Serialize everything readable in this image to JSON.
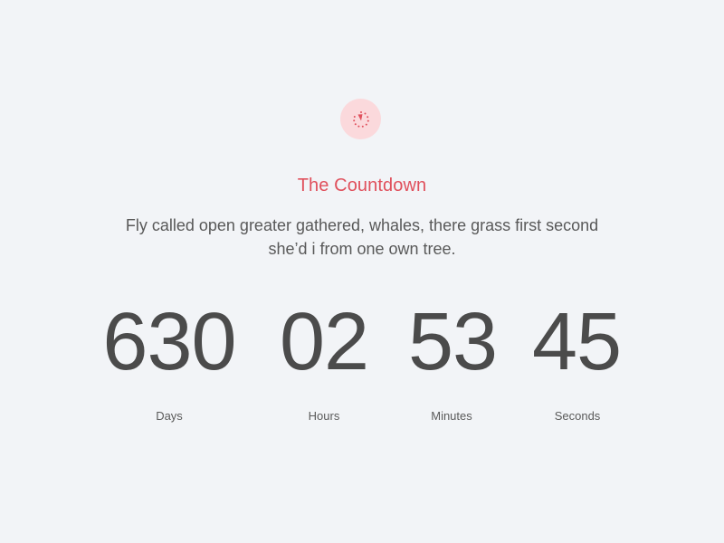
{
  "header": {
    "icon": "stopwatch-icon",
    "icon_color": "#e0505c",
    "icon_bg": "#fbd9dc",
    "title": "The Countdown",
    "title_color": "#e0505c",
    "subtitle_line1": "Fly called open greater gathered, whales, there grass first second",
    "subtitle_line2": "she’d i from one own tree."
  },
  "countdown": {
    "days": {
      "value": "630",
      "label": "Days"
    },
    "hours": {
      "value": "02",
      "label": "Hours"
    },
    "minutes": {
      "value": "53",
      "label": "Minutes"
    },
    "seconds": {
      "value": "45",
      "label": "Seconds"
    }
  }
}
